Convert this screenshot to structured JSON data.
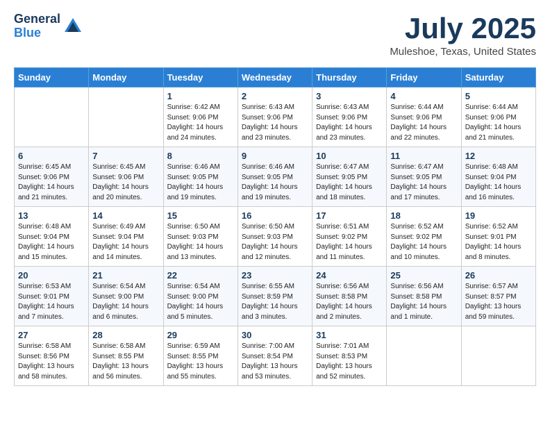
{
  "header": {
    "logo_general": "General",
    "logo_blue": "Blue",
    "title": "July 2025",
    "location": "Muleshoe, Texas, United States"
  },
  "days_of_week": [
    "Sunday",
    "Monday",
    "Tuesday",
    "Wednesday",
    "Thursday",
    "Friday",
    "Saturday"
  ],
  "weeks": [
    [
      {
        "day": "",
        "content": ""
      },
      {
        "day": "",
        "content": ""
      },
      {
        "day": "1",
        "content": "Sunrise: 6:42 AM\nSunset: 9:06 PM\nDaylight: 14 hours and 24 minutes."
      },
      {
        "day": "2",
        "content": "Sunrise: 6:43 AM\nSunset: 9:06 PM\nDaylight: 14 hours and 23 minutes."
      },
      {
        "day": "3",
        "content": "Sunrise: 6:43 AM\nSunset: 9:06 PM\nDaylight: 14 hours and 23 minutes."
      },
      {
        "day": "4",
        "content": "Sunrise: 6:44 AM\nSunset: 9:06 PM\nDaylight: 14 hours and 22 minutes."
      },
      {
        "day": "5",
        "content": "Sunrise: 6:44 AM\nSunset: 9:06 PM\nDaylight: 14 hours and 21 minutes."
      }
    ],
    [
      {
        "day": "6",
        "content": "Sunrise: 6:45 AM\nSunset: 9:06 PM\nDaylight: 14 hours and 21 minutes."
      },
      {
        "day": "7",
        "content": "Sunrise: 6:45 AM\nSunset: 9:06 PM\nDaylight: 14 hours and 20 minutes."
      },
      {
        "day": "8",
        "content": "Sunrise: 6:46 AM\nSunset: 9:05 PM\nDaylight: 14 hours and 19 minutes."
      },
      {
        "day": "9",
        "content": "Sunrise: 6:46 AM\nSunset: 9:05 PM\nDaylight: 14 hours and 19 minutes."
      },
      {
        "day": "10",
        "content": "Sunrise: 6:47 AM\nSunset: 9:05 PM\nDaylight: 14 hours and 18 minutes."
      },
      {
        "day": "11",
        "content": "Sunrise: 6:47 AM\nSunset: 9:05 PM\nDaylight: 14 hours and 17 minutes."
      },
      {
        "day": "12",
        "content": "Sunrise: 6:48 AM\nSunset: 9:04 PM\nDaylight: 14 hours and 16 minutes."
      }
    ],
    [
      {
        "day": "13",
        "content": "Sunrise: 6:48 AM\nSunset: 9:04 PM\nDaylight: 14 hours and 15 minutes."
      },
      {
        "day": "14",
        "content": "Sunrise: 6:49 AM\nSunset: 9:04 PM\nDaylight: 14 hours and 14 minutes."
      },
      {
        "day": "15",
        "content": "Sunrise: 6:50 AM\nSunset: 9:03 PM\nDaylight: 14 hours and 13 minutes."
      },
      {
        "day": "16",
        "content": "Sunrise: 6:50 AM\nSunset: 9:03 PM\nDaylight: 14 hours and 12 minutes."
      },
      {
        "day": "17",
        "content": "Sunrise: 6:51 AM\nSunset: 9:02 PM\nDaylight: 14 hours and 11 minutes."
      },
      {
        "day": "18",
        "content": "Sunrise: 6:52 AM\nSunset: 9:02 PM\nDaylight: 14 hours and 10 minutes."
      },
      {
        "day": "19",
        "content": "Sunrise: 6:52 AM\nSunset: 9:01 PM\nDaylight: 14 hours and 8 minutes."
      }
    ],
    [
      {
        "day": "20",
        "content": "Sunrise: 6:53 AM\nSunset: 9:01 PM\nDaylight: 14 hours and 7 minutes."
      },
      {
        "day": "21",
        "content": "Sunrise: 6:54 AM\nSunset: 9:00 PM\nDaylight: 14 hours and 6 minutes."
      },
      {
        "day": "22",
        "content": "Sunrise: 6:54 AM\nSunset: 9:00 PM\nDaylight: 14 hours and 5 minutes."
      },
      {
        "day": "23",
        "content": "Sunrise: 6:55 AM\nSunset: 8:59 PM\nDaylight: 14 hours and 3 minutes."
      },
      {
        "day": "24",
        "content": "Sunrise: 6:56 AM\nSunset: 8:58 PM\nDaylight: 14 hours and 2 minutes."
      },
      {
        "day": "25",
        "content": "Sunrise: 6:56 AM\nSunset: 8:58 PM\nDaylight: 14 hours and 1 minute."
      },
      {
        "day": "26",
        "content": "Sunrise: 6:57 AM\nSunset: 8:57 PM\nDaylight: 13 hours and 59 minutes."
      }
    ],
    [
      {
        "day": "27",
        "content": "Sunrise: 6:58 AM\nSunset: 8:56 PM\nDaylight: 13 hours and 58 minutes."
      },
      {
        "day": "28",
        "content": "Sunrise: 6:58 AM\nSunset: 8:55 PM\nDaylight: 13 hours and 56 minutes."
      },
      {
        "day": "29",
        "content": "Sunrise: 6:59 AM\nSunset: 8:55 PM\nDaylight: 13 hours and 55 minutes."
      },
      {
        "day": "30",
        "content": "Sunrise: 7:00 AM\nSunset: 8:54 PM\nDaylight: 13 hours and 53 minutes."
      },
      {
        "day": "31",
        "content": "Sunrise: 7:01 AM\nSunset: 8:53 PM\nDaylight: 13 hours and 52 minutes."
      },
      {
        "day": "",
        "content": ""
      },
      {
        "day": "",
        "content": ""
      }
    ]
  ]
}
